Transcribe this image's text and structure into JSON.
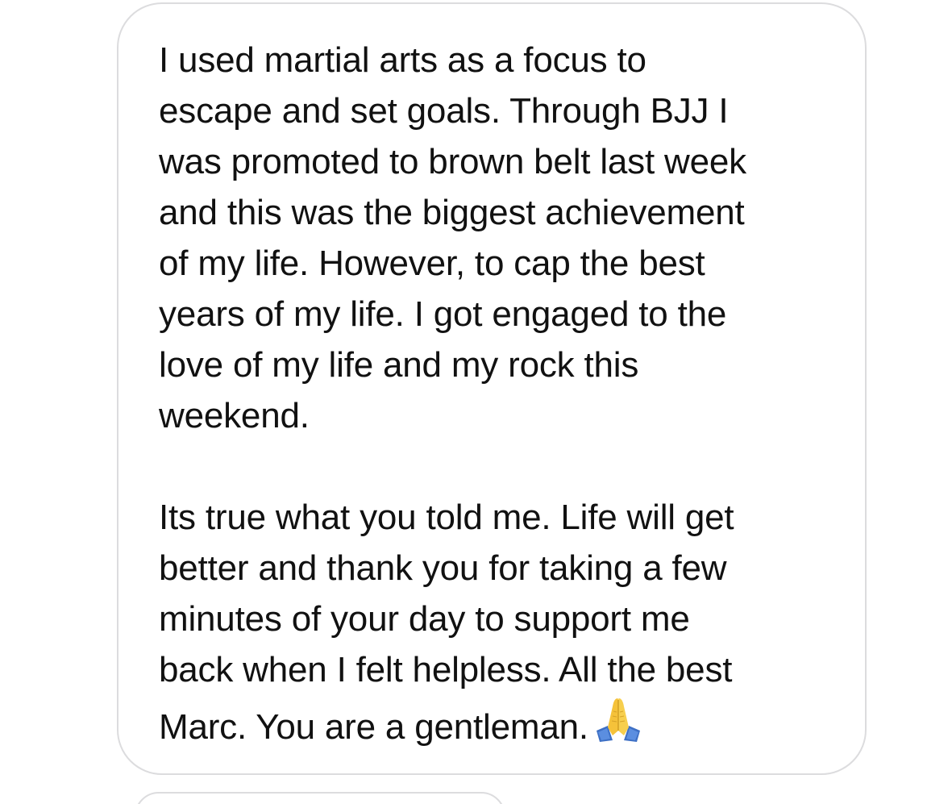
{
  "message": {
    "paragraph_1": [
      "I used martial arts as a focus to",
      "escape and set goals. Through BJJ I",
      "was promoted to brown belt last week",
      "and this was the biggest achievement",
      "of my life. However, to cap the best",
      "years of my life. I got engaged to the",
      "love of my life and my rock this",
      "weekend."
    ],
    "paragraph_2": [
      "Its true what you told me. Life will get",
      "better and thank you for taking a few",
      "minutes of your day to support me",
      "back when I felt helpless. All the best",
      "Marc. You are a gentleman."
    ],
    "trailing_emoji": "folded-hands-icon"
  },
  "colors": {
    "bubble_border": "#dcdcde",
    "text": "#111111",
    "background": "#ffffff"
  }
}
